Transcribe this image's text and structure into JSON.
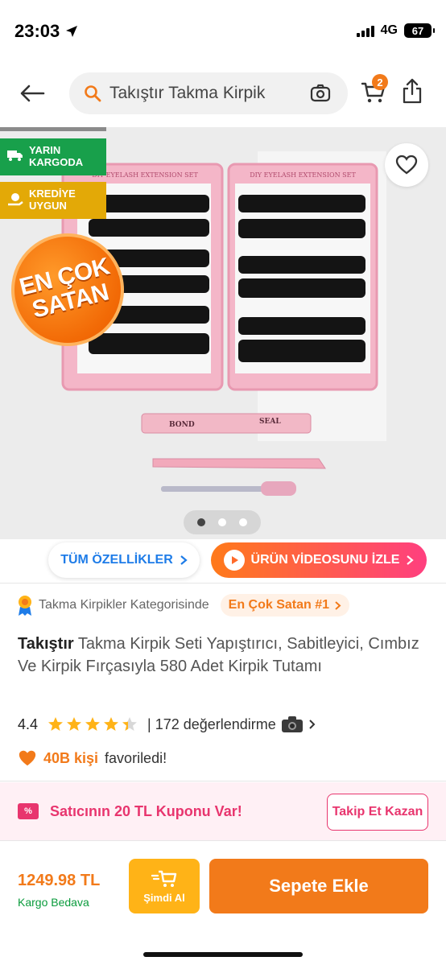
{
  "status_bar": {
    "time": "23:03",
    "network": "4G",
    "battery": "67"
  },
  "header": {
    "search_placeholder": "Takıştır Takma Kirpik",
    "cart_count": "2"
  },
  "gallery": {
    "tags": [
      {
        "line1": "YARIN",
        "line2": "KARGODA",
        "color": "#18a04b"
      },
      {
        "line1": "KREDİYE",
        "line2": "UYGUN",
        "color": "#e3a907"
      }
    ],
    "badge": {
      "line1": "EN ÇOK",
      "line2": "SATAN"
    },
    "product_text": {
      "box_label": "DIY EYELASH EXTENSION SET",
      "tube_left": "BOND",
      "tube_right": "SEAL"
    },
    "page_count": 3,
    "active_page": 1
  },
  "actions": {
    "features_label": "TÜM ÖZELLİKLER",
    "video_label": "ÜRÜN VİDEOSUNU İZLE"
  },
  "category": {
    "text": "Takma Kirpikler Kategorisinde",
    "chip": "En Çok Satan #1"
  },
  "product": {
    "brand": "Takıştır",
    "name": " Takma Kirpik Seti Yapıştırıcı, Sabitleyici, Cımbız Ve Kirpik Fırçasıyla 580 Adet Kirpik Tutamı",
    "rating": "4.4",
    "rating_value": 4.4,
    "review_text": "| 172 değerlendirme"
  },
  "favorites": {
    "count": "40B kişi",
    "label": "favoriledi!"
  },
  "coupon": {
    "icon_text": "%",
    "text": "Satıcının 20 TL Kuponu Var!",
    "button": "Takip Et Kazan"
  },
  "bottom": {
    "price": "1249.98 TL",
    "shipping": "Kargo Bedava",
    "buy_now": "Şimdi Al",
    "add_to_cart": "Sepete Ekle"
  },
  "colors": {
    "accent": "#f27a1a",
    "coupon": "#e8356e",
    "link": "#1e7ce8",
    "shipping": "#0a9b3c"
  }
}
